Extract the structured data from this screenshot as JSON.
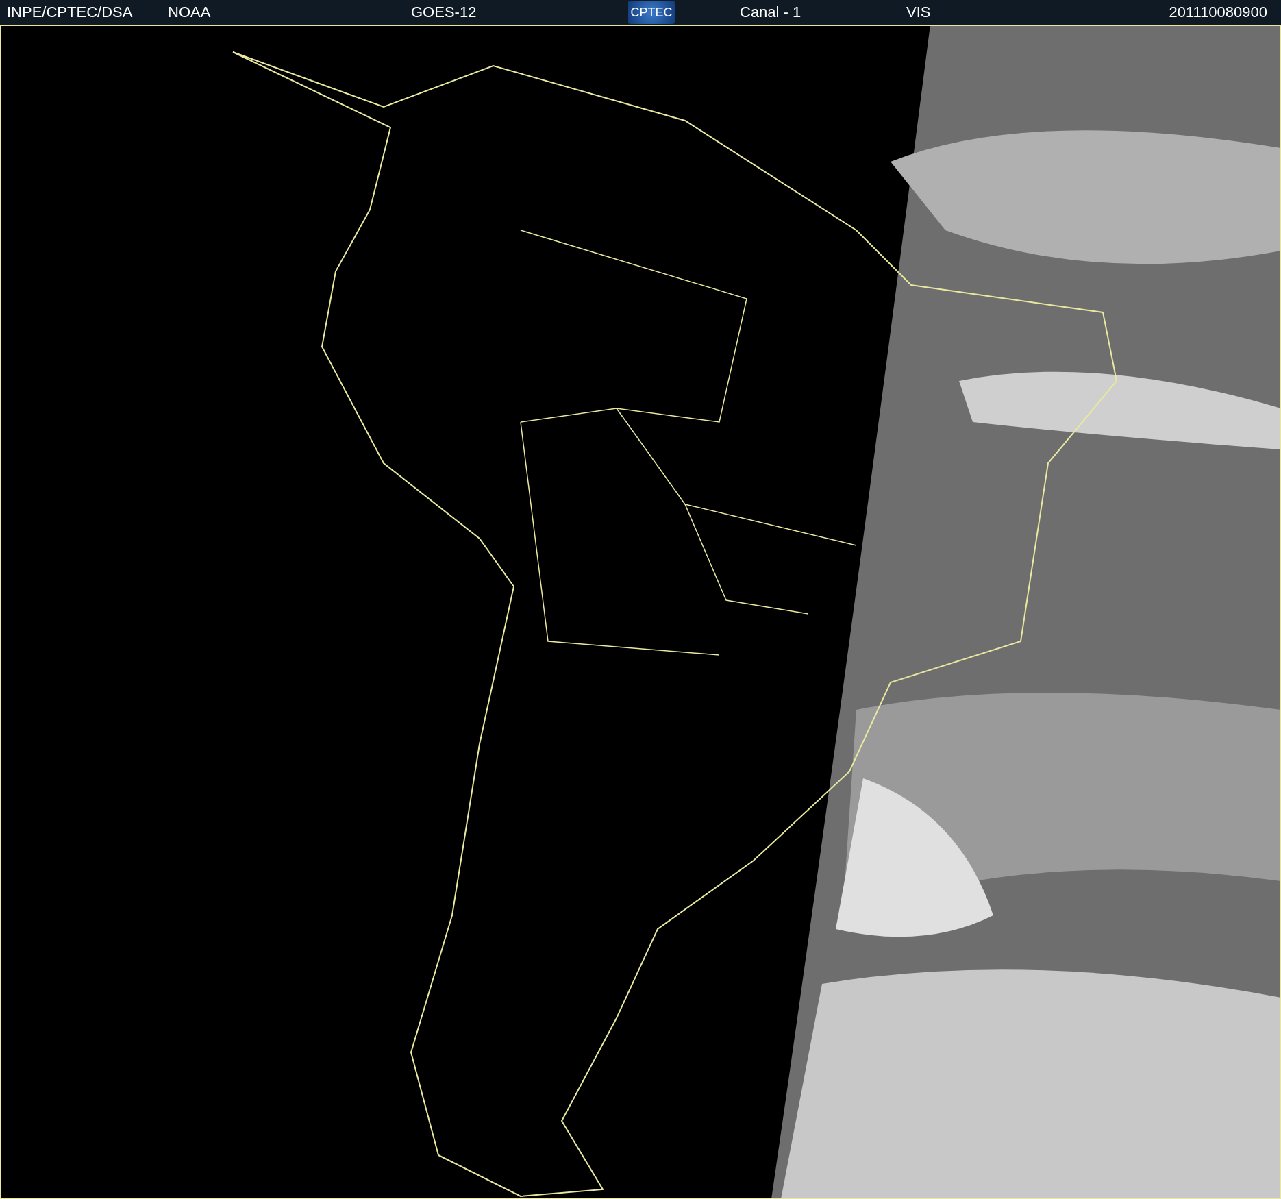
{
  "header": {
    "items": [
      {
        "kind": "text",
        "text": "INPE/CPTEC/DSA"
      },
      {
        "kind": "text",
        "text": "NOAA"
      },
      {
        "kind": "text",
        "text": "GOES-12"
      },
      {
        "kind": "logo",
        "text": "CPTEC"
      },
      {
        "kind": "text",
        "text": "Canal - 1"
      },
      {
        "kind": "text",
        "text": "VIS"
      },
      {
        "kind": "text",
        "text": "201110080900"
      }
    ]
  }
}
